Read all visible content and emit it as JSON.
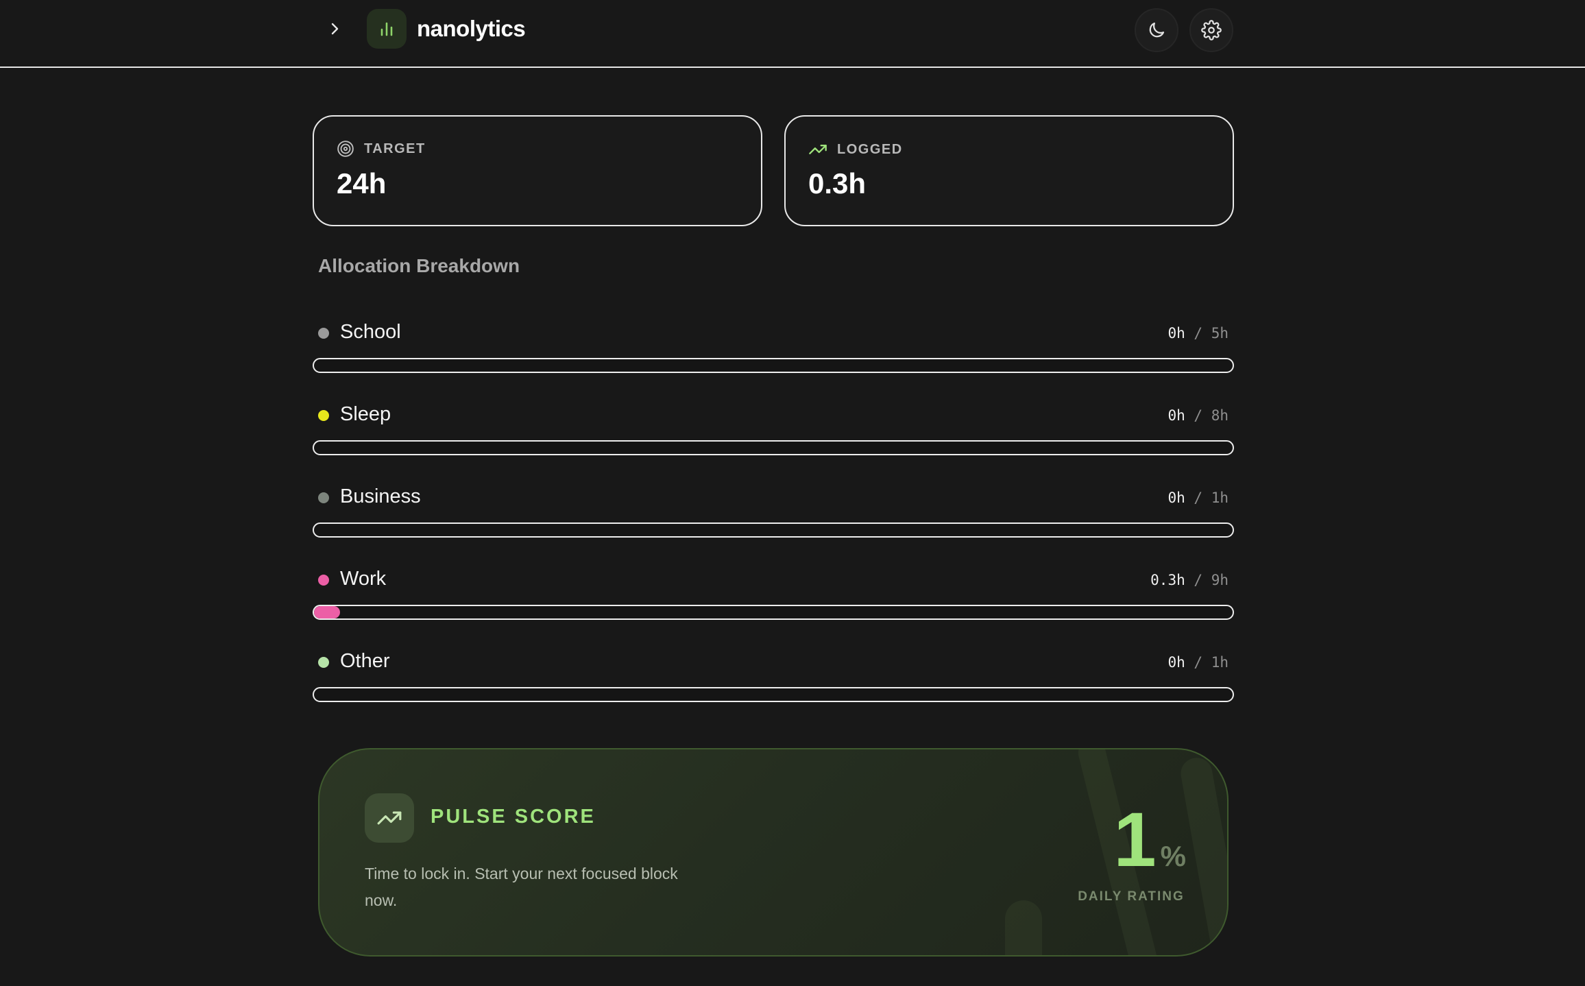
{
  "header": {
    "brand": "nanolytics",
    "icons": {
      "expand": "chevron-right-icon",
      "logo": "bar-chart-icon",
      "theme": "moon-icon",
      "settings": "gear-icon"
    }
  },
  "stats": {
    "target": {
      "label": "TARGET",
      "value": "24h",
      "icon": "target-icon"
    },
    "logged": {
      "label": "LOGGED",
      "value": "0.3h",
      "icon": "trending-up-icon"
    }
  },
  "allocation": {
    "title": "Allocation Breakdown",
    "items": [
      {
        "name": "School",
        "logged": "0h",
        "goal": "5h",
        "color": "#9a9a9a",
        "fraction": 0
      },
      {
        "name": "Sleep",
        "logged": "0h",
        "goal": "8h",
        "color": "#e8e81c",
        "fraction": 0
      },
      {
        "name": "Business",
        "logged": "0h",
        "goal": "1h",
        "color": "#7d857d",
        "fraction": 0
      },
      {
        "name": "Work",
        "logged": "0.3h",
        "goal": "9h",
        "color": "#ec5fa6",
        "fraction": 0.028
      },
      {
        "name": "Other",
        "logged": "0h",
        "goal": "1h",
        "color": "#b6e3a8",
        "fraction": 0
      }
    ],
    "separator": "/"
  },
  "pulse": {
    "title": "PULSE SCORE",
    "message": "Time to lock in. Start your next focused block now.",
    "score": "1",
    "unit": "%",
    "rating_label": "DAILY RATING",
    "icon": "trending-up-icon",
    "accent": "#9fe37c"
  }
}
